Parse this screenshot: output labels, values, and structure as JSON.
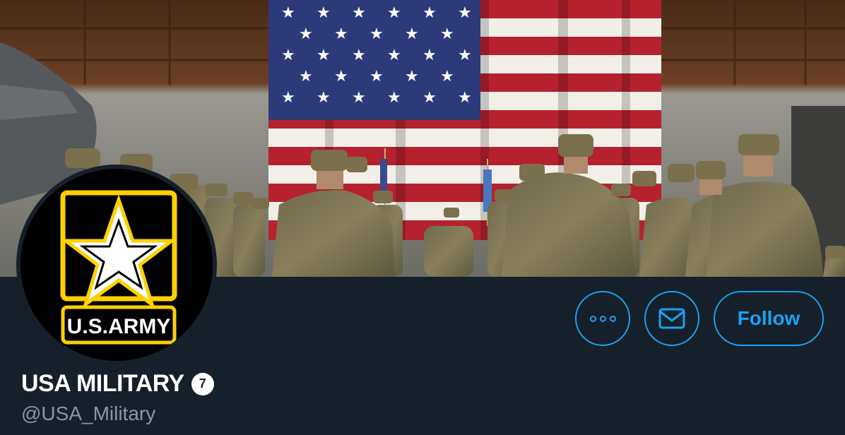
{
  "profile": {
    "display_name": "USA MILITARY",
    "badge_count": "7",
    "handle": "@USA_Military"
  },
  "actions": {
    "follow_label": "Follow"
  },
  "avatar": {
    "logo_text": "U.S.ARMY"
  },
  "colors": {
    "background": "#15202b",
    "accent": "#1da1f2",
    "handle_text": "#8899a6",
    "logo_gold": "#ffd100"
  },
  "icons": {
    "more": "more-dots-icon",
    "message": "envelope-icon",
    "star": "star-icon"
  }
}
